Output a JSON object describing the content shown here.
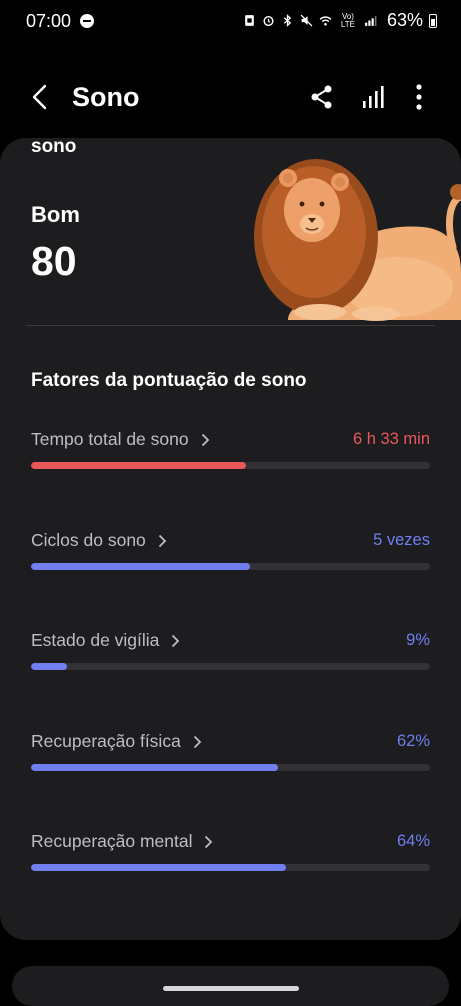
{
  "status_bar": {
    "time": "07:00",
    "network_label": "Vo) LTE",
    "battery": "63%"
  },
  "header": {
    "title": "Sono"
  },
  "summary": {
    "clipped_title": "sono",
    "score_label": "Bom",
    "score_value": "80"
  },
  "factors": {
    "title": "Fatores da pontuação de sono",
    "items": [
      {
        "label": "Tempo total de sono",
        "value": "6 h 33 min",
        "level": 0.54,
        "color": "#e8575a"
      },
      {
        "label": "Ciclos do sono",
        "value": "5 vezes",
        "level": 0.55,
        "color": "#6f7ff0"
      },
      {
        "label": "Estado de vigília",
        "value": "9%",
        "level": 0.09,
        "color": "#6f7ff0"
      },
      {
        "label": "Recuperação física",
        "value": "62%",
        "level": 0.62,
        "color": "#6f7ff0"
      },
      {
        "label": "Recuperação mental",
        "value": "64%",
        "level": 0.64,
        "color": "#6f7ff0"
      }
    ]
  },
  "icons": {
    "back": "back-arrow-icon",
    "share": "share-icon",
    "chart": "bar-chart-icon",
    "more": "more-vertical-icon"
  },
  "colors": {
    "background": "#000000",
    "card": "#1d1d20",
    "accent_blue": "#6f7ff0",
    "accent_red": "#e8575a"
  }
}
